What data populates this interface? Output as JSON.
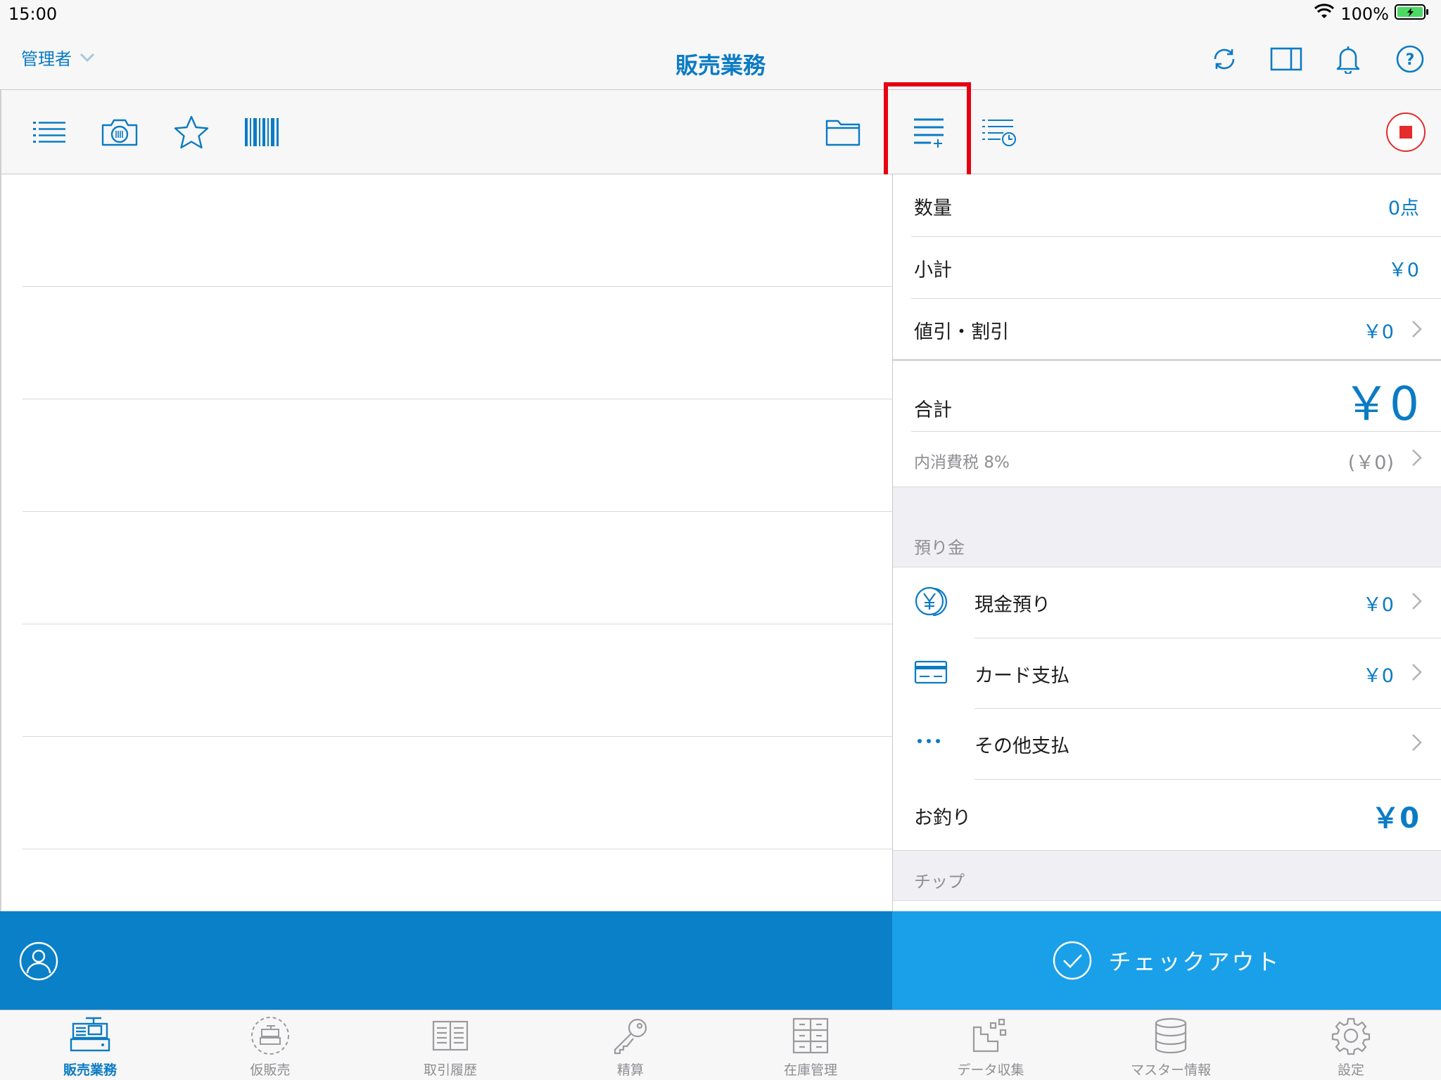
{
  "status_bar": {
    "time": "15:00",
    "battery": "100%"
  },
  "nav": {
    "user": "管理者",
    "title": "販売業務"
  },
  "summary": {
    "quantity_label": "数量",
    "quantity_value": "0点",
    "subtotal_label": "小計",
    "subtotal_value": "￥0",
    "discount_label": "値引・割引",
    "discount_value": "￥0",
    "total_label": "合計",
    "total_value": "￥0",
    "tax_label": "内消費税 8%",
    "tax_value": "(￥0)"
  },
  "deposit": {
    "section_label": "預り金",
    "cash_label": "現金預り",
    "cash_value": "￥0",
    "card_label": "カード支払",
    "card_value": "￥0",
    "other_label": "その他支払",
    "change_label": "お釣り",
    "change_value": "￥0"
  },
  "tip": {
    "section_label": "チップ"
  },
  "checkout": {
    "label": "チェックアウト"
  },
  "tabs": [
    {
      "label": "販売業務",
      "icon": "register-icon",
      "active": true
    },
    {
      "label": "仮販売",
      "icon": "temp-sale-icon",
      "active": false
    },
    {
      "label": "取引履歴",
      "icon": "history-book-icon",
      "active": false
    },
    {
      "label": "精算",
      "icon": "key-icon",
      "active": false
    },
    {
      "label": "在庫管理",
      "icon": "inventory-icon",
      "active": false
    },
    {
      "label": "データ収集",
      "icon": "data-collect-icon",
      "active": false
    },
    {
      "label": "マスター情報",
      "icon": "database-icon",
      "active": false
    },
    {
      "label": "設定",
      "icon": "gear-icon",
      "active": false
    }
  ],
  "colors": {
    "accent": "#0a7bc4",
    "customer_bar": "#0a80c8",
    "checkout_bar": "#19a0e8",
    "highlight": "#e60012",
    "stop": "#e52b2b"
  }
}
